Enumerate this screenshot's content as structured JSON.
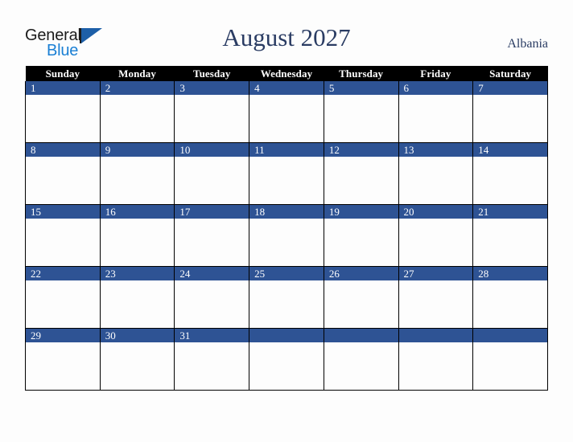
{
  "brand": {
    "name_part1": "General",
    "name_part2": "Blue",
    "triangle_icon": "triangle-icon"
  },
  "header": {
    "title": "August 2027",
    "country": "Albania"
  },
  "calendar": {
    "weekday_headers": [
      "Sunday",
      "Monday",
      "Tuesday",
      "Wednesday",
      "Thursday",
      "Friday",
      "Saturday"
    ],
    "weeks": [
      [
        "1",
        "2",
        "3",
        "4",
        "5",
        "6",
        "7"
      ],
      [
        "8",
        "9",
        "10",
        "11",
        "12",
        "13",
        "14"
      ],
      [
        "15",
        "16",
        "17",
        "18",
        "19",
        "20",
        "21"
      ],
      [
        "22",
        "23",
        "24",
        "25",
        "26",
        "27",
        "28"
      ],
      [
        "29",
        "30",
        "31",
        "",
        "",
        "",
        ""
      ]
    ]
  },
  "colors": {
    "accent_blue": "#2e5394",
    "header_black": "#000000",
    "title_navy": "#2a3c63",
    "logo_blue": "#1a7fd4",
    "page_background": "#fdfdfd"
  }
}
